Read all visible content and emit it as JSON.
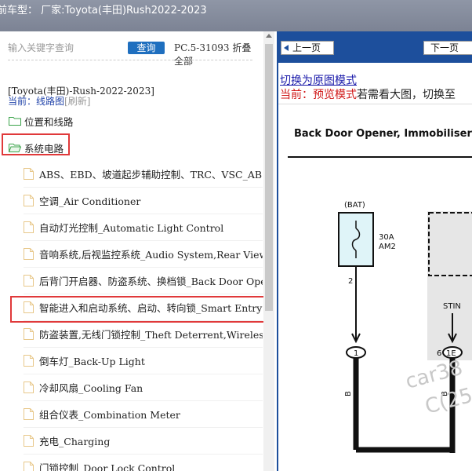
{
  "header": {
    "text": "前车型：  厂家:Toyota(丰田)Rush2022-2023"
  },
  "search": {
    "placeholder": "输入关键字查询",
    "button_label": "查询",
    "pc_label": "PC.5-31093 折叠全部"
  },
  "breadcrumb": "[Toyota(丰田)-Rush-2022-2023]",
  "current": {
    "label": "当前：线路图",
    "refresh": "[刷新]"
  },
  "tree": {
    "folders": [
      {
        "label": "位置和线路"
      },
      {
        "label": "系统电路"
      }
    ],
    "items": [
      {
        "label": "ABS、EBD、坡道起步辅助控制、TRC、VSC_ABS"
      },
      {
        "label": "空调_Air Conditioner"
      },
      {
        "label": "自动灯光控制_Automatic Light Control"
      },
      {
        "label": "音响系统,后视监控系统_Audio System,Rear View M"
      },
      {
        "label": "后背门开启器、防盗系统、换档锁_Back Door Ope"
      },
      {
        "label": "智能进入和启动系统、启动、转向锁_Smart Entry"
      },
      {
        "label": "防盗装置,无线门锁控制_Theft Deterrent,Wireless Do"
      },
      {
        "label": "倒车灯_Back-Up Light"
      },
      {
        "label": "冷却风扇_Cooling Fan"
      },
      {
        "label": "组合仪表_Combination Meter"
      },
      {
        "label": "充电_Charging"
      },
      {
        "label": "门锁控制_Door Lock Control"
      }
    ]
  },
  "viewer": {
    "prev_label": "上一页",
    "next_label": "下一页",
    "switch_link": "切换为原图模式",
    "mode_prefix": "当前：预览模式",
    "mode_suffix": "若需看大图，切换至"
  },
  "diagram": {
    "title": "Back Door Opener, Immobiliser S",
    "bat_label": "(BAT)",
    "fuse_rating": "30A",
    "fuse_name": "AM2",
    "pin_left": "2",
    "connector_left": "1",
    "wire_color": "B",
    "stin_label": "STIN",
    "pin_right": "6",
    "connector_right": "1E",
    "watermark_1": "car38",
    "watermark_2": "C(25"
  },
  "colors": {
    "topbar": "#8a91a1",
    "accent_blue": "#1d4f9c",
    "search_button": "#1f6fbf",
    "highlight_red": "#e0393a",
    "folder_green": "#3aa34a",
    "doc_tan": "#e8c88a"
  }
}
